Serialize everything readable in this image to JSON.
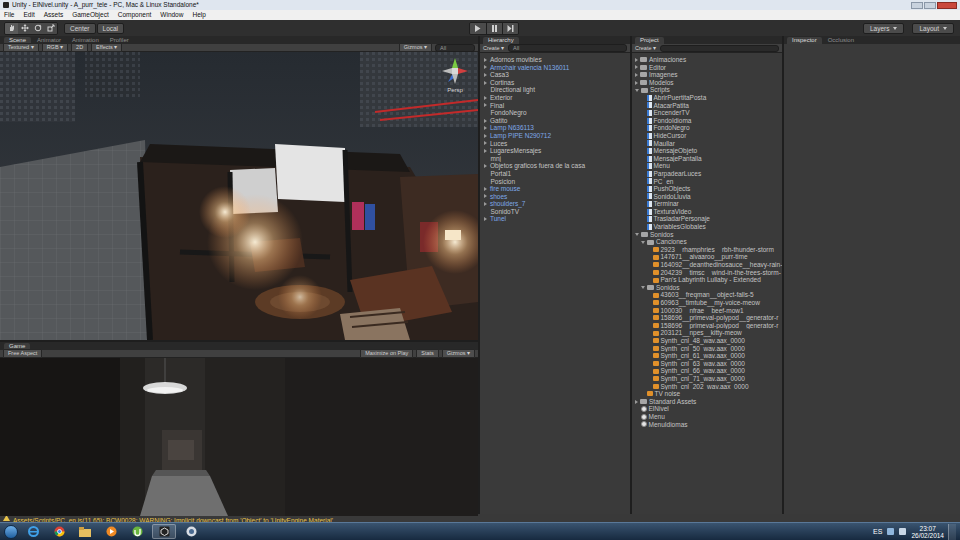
{
  "window": {
    "title": "Unity - ElNivel.unity - A_purr_tele - PC, Mac & Linux Standalone*"
  },
  "menu": [
    "File",
    "Edit",
    "Assets",
    "GameObject",
    "Component",
    "Window",
    "Help"
  ],
  "toolbar": {
    "pivot": "Center",
    "space": "Local",
    "layers": "Layers",
    "layout": "Layout"
  },
  "scene": {
    "tabs": [
      {
        "label": "Scene",
        "selected": true
      },
      {
        "label": "Animator",
        "selected": false
      },
      {
        "label": "Animation",
        "selected": false
      },
      {
        "label": "Profiler",
        "selected": false
      }
    ],
    "controls": [
      "Textured ▾",
      "RGB ▾",
      "2D",
      "Effects ▾"
    ],
    "gizmos": "Gizmos ▾",
    "search": "All",
    "view": "Persp"
  },
  "game": {
    "tabs": [
      {
        "label": "Game",
        "selected": true
      }
    ],
    "aspect": "Free Aspect",
    "controls": [
      "Maximize on Play",
      "Stats",
      "Gizmos ▾"
    ]
  },
  "hierarchy": {
    "tab": "Hierarchy",
    "create": "Create ▾",
    "search": "All",
    "items": [
      {
        "label": "Adornos movibles",
        "expandable": true,
        "color": "#c4c4c4"
      },
      {
        "label": "Armchair valencia N136011",
        "expandable": true,
        "color": "#7fa9e8"
      },
      {
        "label": "Casa3",
        "expandable": true,
        "color": "#c4c4c4"
      },
      {
        "label": "Cortinas",
        "expandable": true,
        "color": "#c4c4c4"
      },
      {
        "label": "Directional light",
        "expandable": false,
        "color": "#c4c4c4"
      },
      {
        "label": "Exterior",
        "expandable": true,
        "color": "#c4c4c4"
      },
      {
        "label": "Final",
        "expandable": true,
        "color": "#c4c4c4"
      },
      {
        "label": "FondoNegro",
        "expandable": false,
        "color": "#c4c4c4"
      },
      {
        "label": "Gatito",
        "expandable": true,
        "color": "#c4c4c4"
      },
      {
        "label": "Lamp N636113",
        "expandable": true,
        "color": "#7fa9e8"
      },
      {
        "label": "Lamp PIPE N290712",
        "expandable": true,
        "color": "#7fa9e8"
      },
      {
        "label": "Luces",
        "expandable": true,
        "color": "#c4c4c4"
      },
      {
        "label": "LugaresMensajes",
        "expandable": true,
        "color": "#c4c4c4"
      },
      {
        "label": "mnj",
        "expandable": false,
        "color": "#c4c4c4"
      },
      {
        "label": "Objetos graficos fuera de la casa",
        "expandable": true,
        "color": "#c4c4c4"
      },
      {
        "label": "Portal1",
        "expandable": false,
        "color": "#c4c4c4"
      },
      {
        "label": "Posicion",
        "expandable": false,
        "color": "#c4c4c4"
      },
      {
        "label": "fire mouse",
        "expandable": true,
        "color": "#7fa9e8"
      },
      {
        "label": "shoes",
        "expandable": true,
        "color": "#7fa9e8"
      },
      {
        "label": "shoulders_7",
        "expandable": true,
        "color": "#7fa9e8"
      },
      {
        "label": "SonidoTV",
        "expandable": false,
        "color": "#c4c4c4"
      },
      {
        "label": "Tunel",
        "expandable": true,
        "color": "#7fa9e8"
      }
    ]
  },
  "project": {
    "tab": "Project",
    "create": "Create ▾",
    "items": [
      {
        "label": "Animaciones",
        "kind": "folder",
        "depth": 0,
        "expanded": false
      },
      {
        "label": "Editor",
        "kind": "folder",
        "depth": 0,
        "expanded": false
      },
      {
        "label": "Imagenes",
        "kind": "folder",
        "depth": 0,
        "expanded": false
      },
      {
        "label": "Modelos",
        "kind": "folder",
        "depth": 0,
        "expanded": false
      },
      {
        "label": "Scripts",
        "kind": "folder",
        "depth": 0,
        "expanded": true
      },
      {
        "label": "AbrirPuertitaPosta",
        "kind": "script",
        "depth": 1,
        "expanded": false
      },
      {
        "label": "AtacarPatita",
        "kind": "script",
        "depth": 1,
        "expanded": false
      },
      {
        "label": "EncenderTV",
        "kind": "script",
        "depth": 1,
        "expanded": false
      },
      {
        "label": "FondoIdioma",
        "kind": "script",
        "depth": 1,
        "expanded": false
      },
      {
        "label": "FondoNegro",
        "kind": "script",
        "depth": 1,
        "expanded": false
      },
      {
        "label": "HideCursor",
        "kind": "script",
        "depth": 1,
        "expanded": false
      },
      {
        "label": "Maullar",
        "kind": "script",
        "depth": 1,
        "expanded": false
      },
      {
        "label": "MensajeObjeto",
        "kind": "script",
        "depth": 1,
        "expanded": false
      },
      {
        "label": "MensajePantalla",
        "kind": "script",
        "depth": 1,
        "expanded": false
      },
      {
        "label": "Menu",
        "kind": "script",
        "depth": 1,
        "expanded": false
      },
      {
        "label": "ParpadearLuces",
        "kind": "script",
        "depth": 1,
        "expanded": false
      },
      {
        "label": "PC_en",
        "kind": "script",
        "depth": 1,
        "expanded": false
      },
      {
        "label": "PushObjects",
        "kind": "script",
        "depth": 1,
        "expanded": false
      },
      {
        "label": "SonidoLluvia",
        "kind": "script",
        "depth": 1,
        "expanded": false
      },
      {
        "label": "Terminar",
        "kind": "script",
        "depth": 1,
        "expanded": false
      },
      {
        "label": "TexturaVideo",
        "kind": "script",
        "depth": 1,
        "expanded": false
      },
      {
        "label": "TrasladarPersonaje",
        "kind": "script",
        "depth": 1,
        "expanded": false
      },
      {
        "label": "VariablesGlobales",
        "kind": "script",
        "depth": 1,
        "expanded": false
      },
      {
        "label": "Sonidos",
        "kind": "folder",
        "depth": 0,
        "expanded": true
      },
      {
        "label": "Canciones",
        "kind": "folder",
        "depth": 1,
        "expanded": true
      },
      {
        "label": "2923__rhamphries__rbh-thunder-storm",
        "kind": "audio",
        "depth": 2,
        "expanded": false
      },
      {
        "label": "147671__aivaaroo__purr-time",
        "kind": "audio",
        "depth": 2,
        "expanded": false
      },
      {
        "label": "164092__deanthedinosauce__heavy-rain-",
        "kind": "audio",
        "depth": 2,
        "expanded": false
      },
      {
        "label": "204239__timsc__wind-in-the-trees-storm-",
        "kind": "audio",
        "depth": 2,
        "expanded": false
      },
      {
        "label": "Pan's Labyrinth Lullaby - Extended",
        "kind": "audio",
        "depth": 2,
        "expanded": false
      },
      {
        "label": "Sonidos",
        "kind": "folder",
        "depth": 1,
        "expanded": true
      },
      {
        "label": "43603__freqman__object-falls-5",
        "kind": "audio",
        "depth": 2,
        "expanded": false
      },
      {
        "label": "60963__timtube__my-voice-meow",
        "kind": "audio",
        "depth": 2,
        "expanded": false
      },
      {
        "label": "100030__nfrae__beef-mow1",
        "kind": "audio",
        "depth": 2,
        "expanded": false
      },
      {
        "label": "158696__primeval-polypod__generator-r",
        "kind": "audio",
        "depth": 2,
        "expanded": false
      },
      {
        "label": "158696__primeval-polypod__generator-r",
        "kind": "audio",
        "depth": 2,
        "expanded": false
      },
      {
        "label": "203121__npes__kitty-meow",
        "kind": "audio",
        "depth": 2,
        "expanded": false
      },
      {
        "label": "Synth_cnl_48_wav.aax_0000",
        "kind": "audio",
        "depth": 2,
        "expanded": false
      },
      {
        "label": "Synth_cnl_50_wav.aax_0000",
        "kind": "audio",
        "depth": 2,
        "expanded": false
      },
      {
        "label": "Synth_cnl_61_wav.aax_0000",
        "kind": "audio",
        "depth": 2,
        "expanded": false
      },
      {
        "label": "Synth_cnl_63_wav.aax_0000",
        "kind": "audio",
        "depth": 2,
        "expanded": false
      },
      {
        "label": "Synth_cnl_66_wav.aax_0000",
        "kind": "audio",
        "depth": 2,
        "expanded": false
      },
      {
        "label": "Synth_cnl_71_wav.aax_0000",
        "kind": "audio",
        "depth": 2,
        "expanded": false
      },
      {
        "label": "Synth_cnl_202_wav.aax_0000",
        "kind": "audio",
        "depth": 2,
        "expanded": false
      },
      {
        "label": "TV noise",
        "kind": "audio",
        "depth": 1,
        "expanded": false
      },
      {
        "label": "Standard Assets",
        "kind": "folder",
        "depth": 0,
        "expanded": false
      },
      {
        "label": "ElNivel",
        "kind": "scene",
        "depth": 0,
        "expanded": false
      },
      {
        "label": "Menu",
        "kind": "scene",
        "depth": 0,
        "expanded": false
      },
      {
        "label": "MenuIdiomas",
        "kind": "scene",
        "depth": 0,
        "expanded": false
      }
    ]
  },
  "inspector": {
    "tabs": [
      {
        "label": "Inspector",
        "selected": true
      },
      {
        "label": "Occlusion",
        "selected": false
      }
    ]
  },
  "console": {
    "message": "Assets/Scripts/PC_en.js(11,65): BCW0028: WARNING: Implicit downcast from 'Object' to 'UnityEngine.Material'."
  },
  "taskbar": {
    "language": "ES",
    "time": "23:07",
    "date": "26/02/2014"
  }
}
